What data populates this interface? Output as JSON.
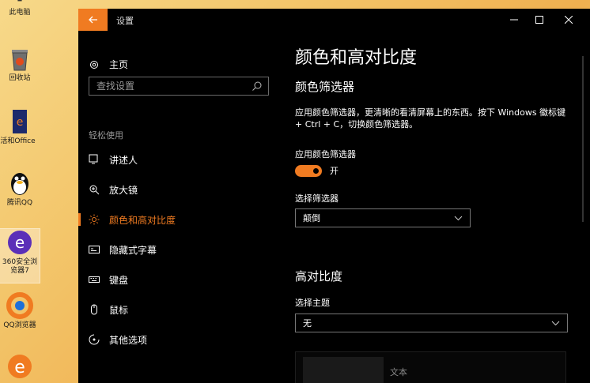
{
  "desktop": {
    "icons": [
      {
        "label": "此电脑"
      },
      {
        "label": "回收站"
      },
      {
        "label": "激活和Office"
      },
      {
        "label": "腾讯QQ"
      },
      {
        "label": "360安全浏览器7"
      },
      {
        "label": "QQ浏览器"
      },
      {
        "label": ""
      }
    ]
  },
  "window": {
    "title": "设置",
    "controls": {
      "minimize": "—",
      "maximize": "☐",
      "close": "✕"
    }
  },
  "sidebar": {
    "home_label": "主页",
    "search_placeholder": "查找设置",
    "section_label": "轻松使用",
    "items": [
      {
        "label": "讲述人",
        "icon": "narrator-icon"
      },
      {
        "label": "放大镜",
        "icon": "magnifier-icon"
      },
      {
        "label": "颜色和高对比度",
        "icon": "brightness-icon",
        "active": true
      },
      {
        "label": "隐藏式字幕",
        "icon": "closed-captions-icon"
      },
      {
        "label": "键盘",
        "icon": "keyboard-icon"
      },
      {
        "label": "鼠标",
        "icon": "mouse-icon"
      },
      {
        "label": "其他选项",
        "icon": "other-options-icon"
      }
    ]
  },
  "content": {
    "page_title": "颜色和高对比度",
    "color_filter_heading": "颜色筛选器",
    "description": "应用颜色筛选器，更清晰的看清屏幕上的东西。按下 Windows 徽标键 + Ctrl + C，切换颜色筛选器。",
    "apply_filter_label": "应用颜色筛选器",
    "toggle_state": "开",
    "select_filter_label": "选择筛选器",
    "select_filter_value": "颠倒",
    "high_contrast_heading": "高对比度",
    "select_theme_label": "选择主题",
    "select_theme_value": "无",
    "preview_text": "文本"
  },
  "colors": {
    "accent": "#f07b21",
    "window_bg": "#000000"
  }
}
